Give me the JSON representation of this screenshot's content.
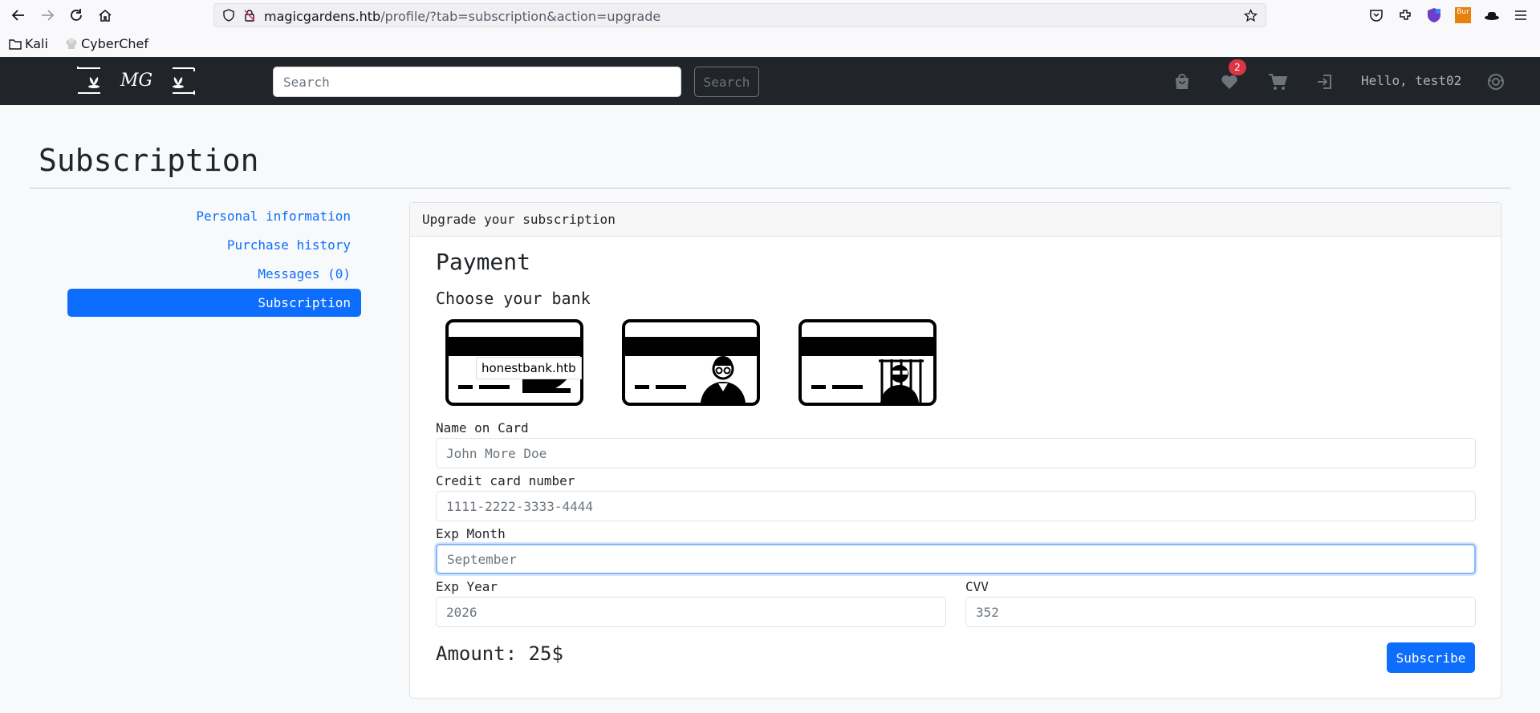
{
  "browser": {
    "url_host": "magicgardens.htb",
    "url_path": "/profile/?tab=subscription&action=upgrade",
    "bookmarks": [
      {
        "label": "Kali",
        "icon": "folder-icon"
      },
      {
        "label": "CyberChef",
        "icon": "chef-hat-icon"
      }
    ],
    "extension_label": "Bur"
  },
  "site_nav": {
    "logo_text": "MG",
    "search_placeholder": "Search",
    "search_button": "Search",
    "wishlist_count": "2",
    "greeting": "Hello, test02"
  },
  "page": {
    "title": "Subscription",
    "sidebar": [
      {
        "label": "Personal information",
        "active": false
      },
      {
        "label": "Purchase history",
        "active": false
      },
      {
        "label": "Messages (0)",
        "active": false
      },
      {
        "label": "Subscription",
        "active": true
      }
    ]
  },
  "card": {
    "header": "Upgrade your subscription",
    "payment_heading": "Payment",
    "bank_heading": "Choose your bank",
    "bank_tooltip": "honestbank.htb",
    "fields": {
      "name_label": "Name on Card",
      "name_placeholder": "John More Doe",
      "number_label": "Credit card number",
      "number_placeholder": "1111-2222-3333-4444",
      "month_label": "Exp Month",
      "month_placeholder": "September",
      "year_label": "Exp Year",
      "year_placeholder": "2026",
      "cvv_label": "CVV",
      "cvv_placeholder": "352"
    },
    "amount": "Amount: 25$",
    "subscribe_button": "Subscribe"
  },
  "colors": {
    "primary": "#0d6efd",
    "navbar": "#212529",
    "badge": "#dc3545"
  }
}
